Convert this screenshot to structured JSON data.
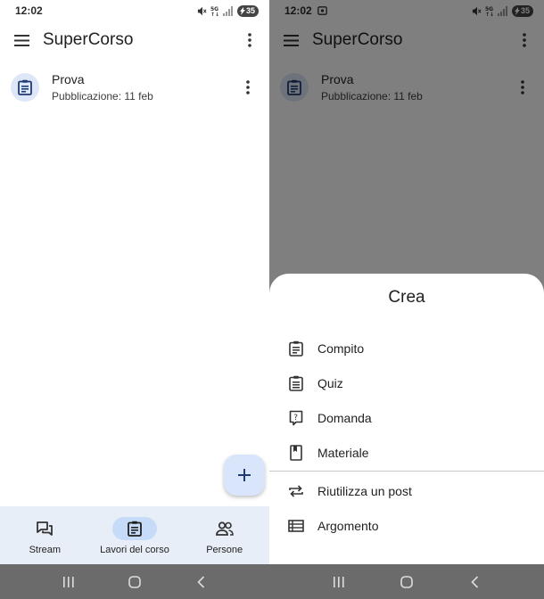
{
  "left_screen": {
    "status": {
      "time": "12:02",
      "battery": "35"
    },
    "app_title": "SuperCorso",
    "assignment": {
      "title": "Prova",
      "subtitle": "Pubblicazione: 11 feb",
      "icon": "assignment-icon"
    },
    "fab_icon": "plus-icon",
    "bottom_nav": [
      {
        "label": "Stream",
        "icon": "stream-icon",
        "active": false
      },
      {
        "label": "Lavori del corso",
        "icon": "assignment-icon",
        "active": true
      },
      {
        "label": "Persone",
        "icon": "people-icon",
        "active": false
      }
    ]
  },
  "right_screen": {
    "status": {
      "time": "12:02",
      "battery": "35"
    },
    "app_title": "SuperCorso",
    "assignment": {
      "title": "Prova",
      "subtitle": "Pubblicazione: 11 feb"
    },
    "sheet": {
      "title": "Crea",
      "items": [
        {
          "label": "Compito",
          "icon": "assignment-icon"
        },
        {
          "label": "Quiz",
          "icon": "quiz-icon"
        },
        {
          "label": "Domanda",
          "icon": "question-icon"
        },
        {
          "label": "Materiale",
          "icon": "book-icon"
        },
        {
          "label": "Riutilizza un post",
          "icon": "repeat-icon"
        },
        {
          "label": "Argomento",
          "icon": "topic-icon"
        }
      ]
    }
  },
  "colors": {
    "accent": "#1f3b73",
    "fab_bg": "#d8e5fb",
    "nav_bg": "#e8eef8",
    "active_pill": "#c6dbf7"
  }
}
